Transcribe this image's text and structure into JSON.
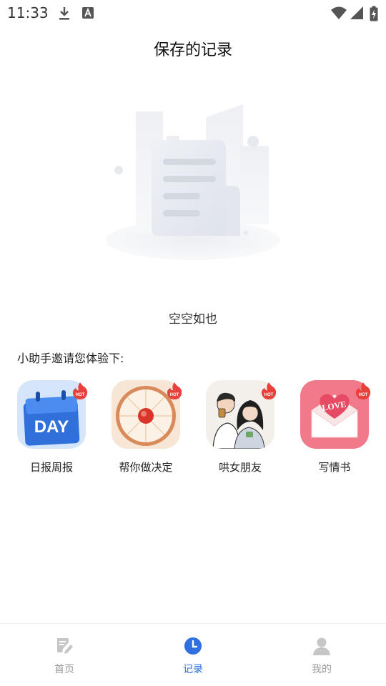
{
  "status_bar": {
    "time": "11:33",
    "icons": [
      "download-icon",
      "a-notification-icon",
      "wifi-icon",
      "signal-icon",
      "battery-charging-icon"
    ]
  },
  "header": {
    "title": "保存的记录"
  },
  "empty_state": {
    "text": "空空如也",
    "illustration": "empty-document-illustration"
  },
  "invite": {
    "text": "小助手邀请您体验下:"
  },
  "apps": [
    {
      "label": "日报周报",
      "icon_text": "DAY",
      "badge": "HOT",
      "color": "#3b7ff0"
    },
    {
      "label": "帮你做决定",
      "badge": "HOT",
      "color": "#e94a3b"
    },
    {
      "label": "哄女朋友",
      "badge": "HOT",
      "color": "#f2eeea"
    },
    {
      "label": "写情书",
      "icon_text": "LOVE",
      "badge": "HOT",
      "color": "#f0788c"
    }
  ],
  "bottom_nav": {
    "items": [
      {
        "label": "首页",
        "icon": "edit-document-icon",
        "active": false
      },
      {
        "label": "记录",
        "icon": "clock-icon",
        "active": true
      },
      {
        "label": "我的",
        "icon": "person-icon",
        "active": false
      }
    ],
    "active_color": "#2f6fe0",
    "inactive_color": "#c4c4c4"
  }
}
